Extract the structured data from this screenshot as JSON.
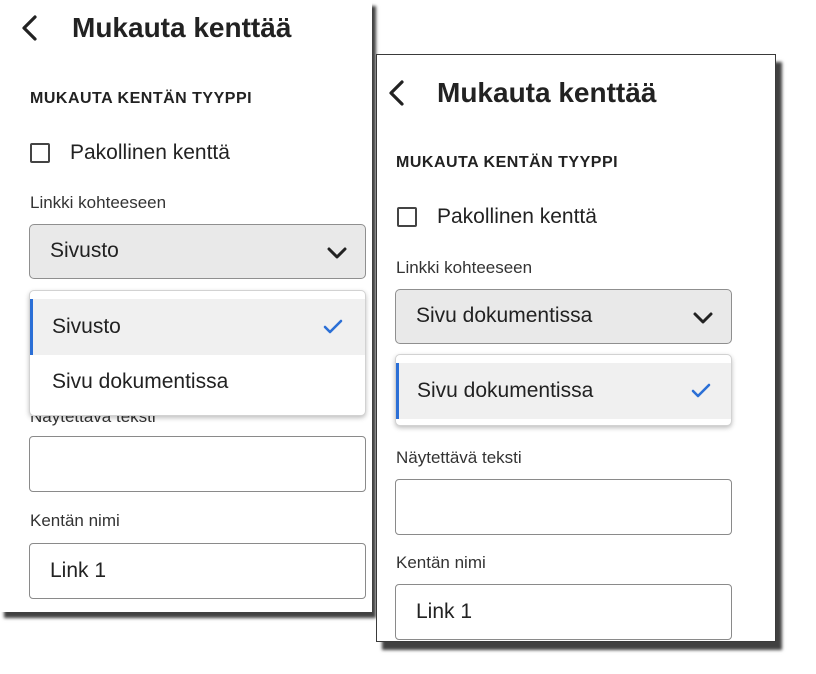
{
  "panels": [
    {
      "header": {
        "title": "Mukauta kenttää"
      },
      "section_heading": "MUKAUTA KENTÄN TYYPPI",
      "required_checkbox": {
        "label": "Pakollinen kenttä",
        "checked": false
      },
      "link_to": {
        "label": "Linkki kohteeseen",
        "selected": "Sivusto",
        "dropdown_open": true,
        "options": [
          {
            "label": "Sivusto",
            "selected": true
          },
          {
            "label": "Sivu dokumentissa",
            "selected": false
          }
        ]
      },
      "display_text": {
        "label": "Näytettävä teksti",
        "value": ""
      },
      "field_name": {
        "label": "Kentän nimi",
        "value": "Link 1"
      }
    },
    {
      "header": {
        "title": "Mukauta kenttää"
      },
      "section_heading": "MUKAUTA KENTÄN TYYPPI",
      "required_checkbox": {
        "label": "Pakollinen kenttä",
        "checked": false
      },
      "link_to": {
        "label": "Linkki kohteeseen",
        "selected": "Sivu dokumentissa",
        "dropdown_open": true,
        "options": [
          {
            "label": "Sivu dokumentissa",
            "selected": true
          }
        ]
      },
      "display_text": {
        "label": "Näytettävä teksti",
        "value": ""
      },
      "field_name": {
        "label": "Kentän nimi",
        "value": "Link 1"
      }
    }
  ],
  "icons": {
    "back": "chevron-left-icon",
    "dropdown": "chevron-down-icon",
    "selected": "checkmark-icon"
  },
  "colors": {
    "accent": "#2b6fd6",
    "select_bg": "#e9e9e9",
    "selected_option_bg": "#f0f0f0"
  }
}
